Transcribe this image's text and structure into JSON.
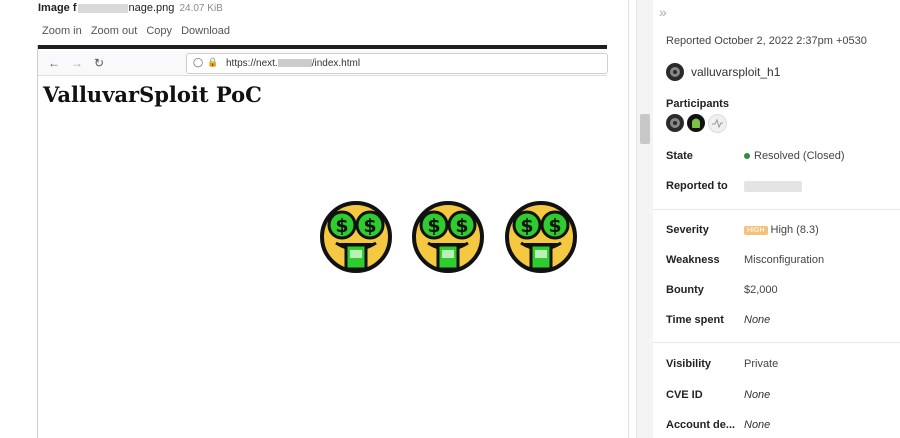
{
  "viewer": {
    "file_prefix": "Image f",
    "file_suffix": "nage.png",
    "file_size": "24.07 KiB",
    "actions": [
      "Zoom in",
      "Zoom out",
      "Copy",
      "Download"
    ]
  },
  "screenshot": {
    "url_prefix": "https://next.",
    "url_suffix": "/index.html",
    "poc_title": "ValluvarSploit PoC",
    "emoji_count": 3
  },
  "report": {
    "reported_text": "Reported October 2, 2022 2:37pm +0530",
    "reporter_name": "valluvarsploit_h1",
    "participants_label": "Participants",
    "state_label": "State",
    "state_value": "Resolved (Closed)",
    "reported_to_label": "Reported to",
    "severity_label": "Severity",
    "severity_badge": "HIGH",
    "severity_value": "High (8.3)",
    "weakness_label": "Weakness",
    "weakness_value": "Misconfiguration",
    "bounty_label": "Bounty",
    "bounty_value": "$2,000",
    "time_spent_label": "Time spent",
    "time_spent_value": "None",
    "visibility_label": "Visibility",
    "visibility_value": "Private",
    "cve_label": "CVE ID",
    "cve_value": "None",
    "account_label": "Account de...",
    "account_value": "None"
  },
  "colors": {
    "state_green": "#2f8f3b",
    "severity_badge": "#f2c27a",
    "emoji_face": "#f5c842",
    "emoji_money": "#2ecc2e"
  }
}
